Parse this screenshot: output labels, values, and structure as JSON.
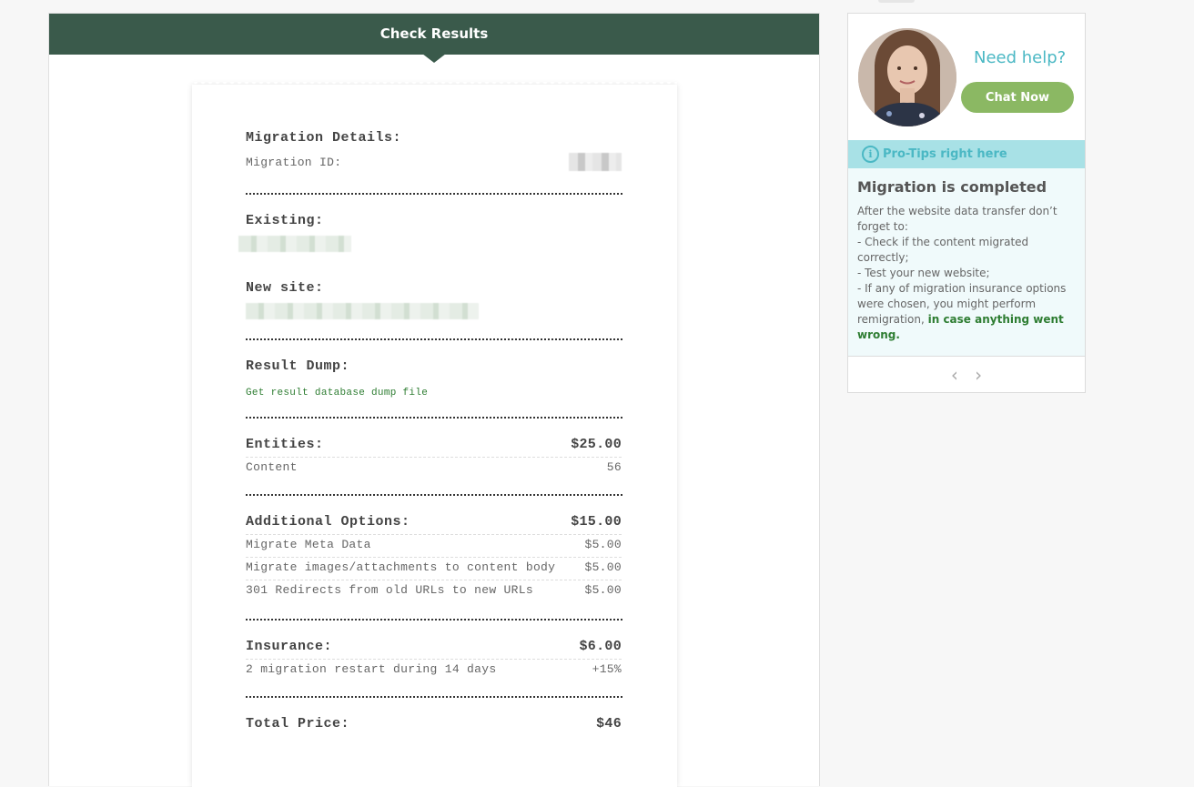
{
  "header": {
    "title": "Check Results"
  },
  "receipt": {
    "migration_details": {
      "title": "Migration Details:",
      "id_label": "Migration ID:"
    },
    "existing": {
      "title": "Existing:"
    },
    "new_site": {
      "title": "New site:"
    },
    "result_dump": {
      "title": "Result Dump:",
      "link": "Get result database dump file"
    },
    "entities": {
      "title": "Entities:",
      "total": "$25.00",
      "items": [
        {
          "label": "Content",
          "value": "56"
        }
      ]
    },
    "additional_options": {
      "title": "Additional Options:",
      "total": "$15.00",
      "items": [
        {
          "label": "Migrate Meta Data",
          "value": "$5.00"
        },
        {
          "label": "Migrate images/attachments to content body",
          "value": "$5.00"
        },
        {
          "label": "301 Redirects from old URLs to new URLs",
          "value": "$5.00"
        }
      ]
    },
    "insurance": {
      "title": "Insurance:",
      "total": "$6.00",
      "items": [
        {
          "label": "2 migration restart during 14 days",
          "value": "+15%"
        }
      ]
    },
    "total": {
      "label": "Total Price:",
      "value": "$46"
    }
  },
  "sidebar": {
    "need_help": "Need help?",
    "chat_button": "Chat Now",
    "tips_label": "Pro-Tips right here",
    "tip": {
      "title": "Migration is completed",
      "intro": "After the website data transfer don’t forget to:",
      "line1": "- Check if the content migrated correctly;",
      "line2": "- Test your new website;",
      "line3": "- If any of migration insurance options were chosen, you might perform remigration,",
      "highlight": "in case anything went wrong."
    },
    "prev_arrow": "‹",
    "next_arrow": "›"
  },
  "colors": {
    "header_bg": "#3a5a4b",
    "accent_teal": "#4bb8c4",
    "chat_button": "#8bb863",
    "link_green": "#2e7d32"
  }
}
